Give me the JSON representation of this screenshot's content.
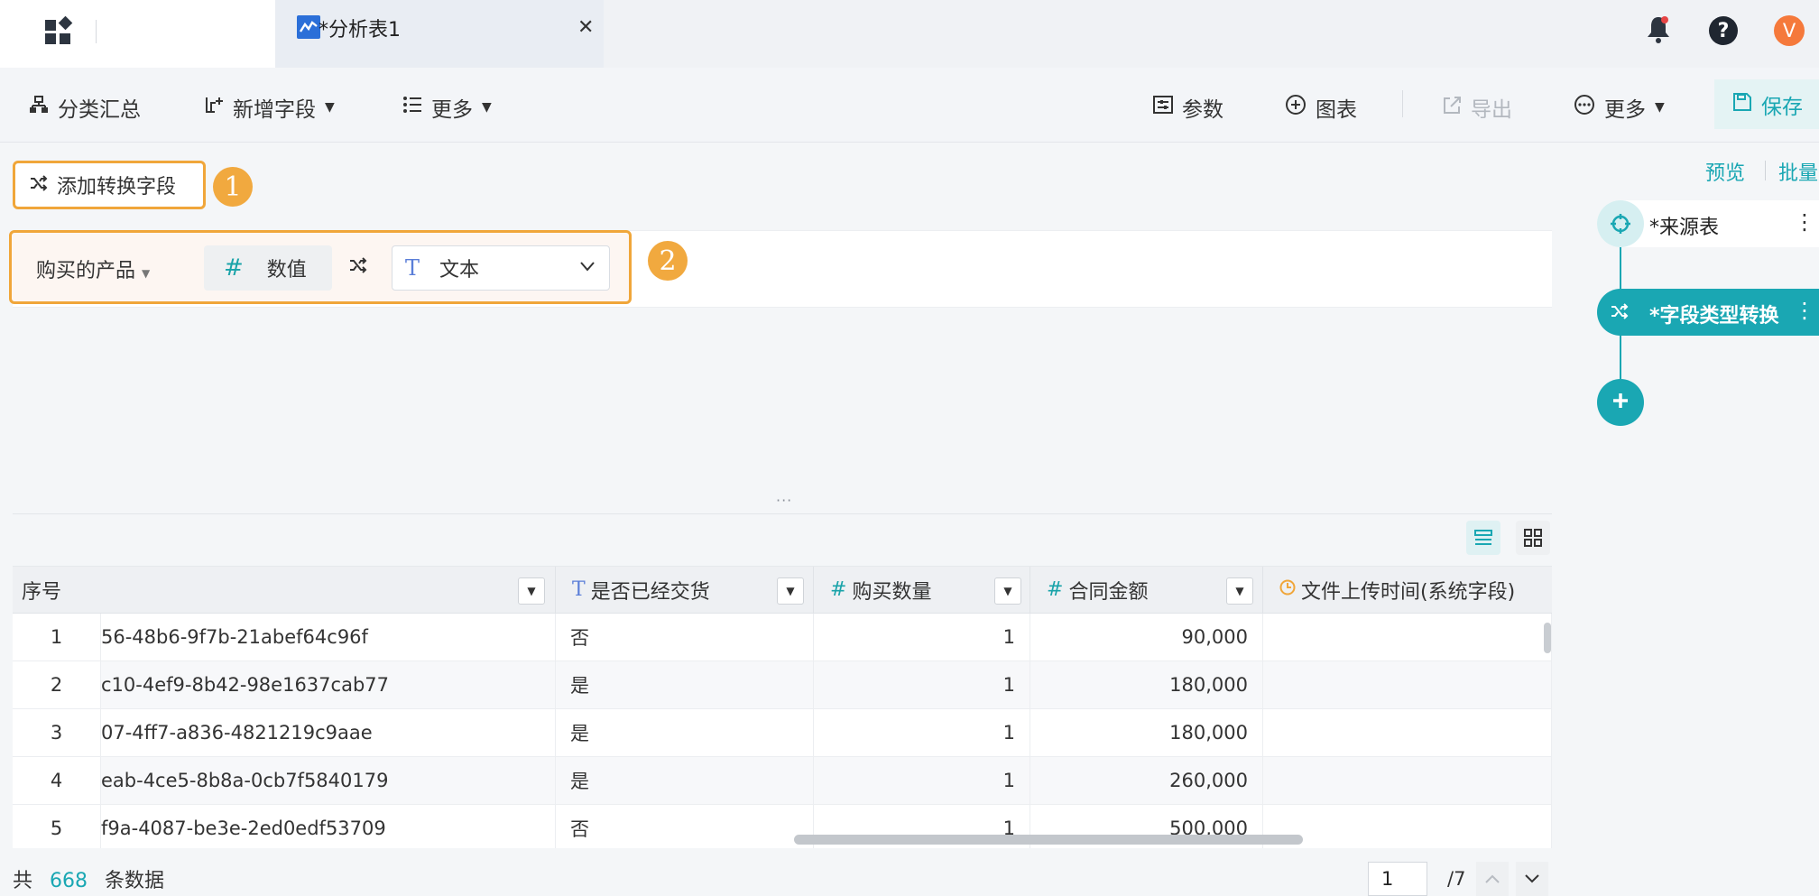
{
  "tab": {
    "title": "*分析表1"
  },
  "toolbar": {
    "group_summary": "分类汇总",
    "add_field": "新增字段",
    "more_left": "更多",
    "params": "参数",
    "chart": "图表",
    "export": "导出",
    "more_right": "更多",
    "save": "保存"
  },
  "header": {
    "avatar_letter": "V"
  },
  "steps": {
    "add_convert_field": "添加转换字段",
    "badge1": "1",
    "badge2": "2"
  },
  "conversion": {
    "field_name": "购买的产品",
    "from_type": "数值",
    "to_type": "文本"
  },
  "right_panel": {
    "preview": "预览",
    "batch": "批量",
    "node_source": "*来源表",
    "node_convert": "*字段类型转换"
  },
  "resizer": "···",
  "table": {
    "columns": [
      {
        "label": "序号"
      },
      {
        "label": "是否已经交货",
        "type_icon": "text-type"
      },
      {
        "label": "购买数量",
        "type_icon": "number-type"
      },
      {
        "label": "合同金额",
        "type_icon": "number-type"
      },
      {
        "label": "文件上传时间(系统字段)",
        "type_icon": "clock-type"
      }
    ],
    "rows": [
      {
        "idx": "1",
        "id": "56-48b6-9f7b-21abef64c96f",
        "delivered": "否",
        "qty": "1",
        "amount": "90,000"
      },
      {
        "idx": "2",
        "id": "c10-4ef9-8b42-98e1637cab77",
        "delivered": "是",
        "qty": "1",
        "amount": "180,000"
      },
      {
        "idx": "3",
        "id": "07-4ff7-a836-4821219c9aae",
        "delivered": "是",
        "qty": "1",
        "amount": "180,000"
      },
      {
        "idx": "4",
        "id": "eab-4ce5-8b8a-0cb7f5840179",
        "delivered": "是",
        "qty": "1",
        "amount": "260,000"
      },
      {
        "idx": "5",
        "id": "f9a-4087-be3e-2ed0edf53709",
        "delivered": "否",
        "qty": "1",
        "amount": "500,000"
      }
    ]
  },
  "footer": {
    "prefix": "共",
    "count": "668",
    "suffix": "条数据",
    "page": "1",
    "total_pages": "/7"
  },
  "colors": {
    "accent": "#1aa7b3",
    "highlight": "#f0a63a",
    "avatar": "#f5793b"
  }
}
